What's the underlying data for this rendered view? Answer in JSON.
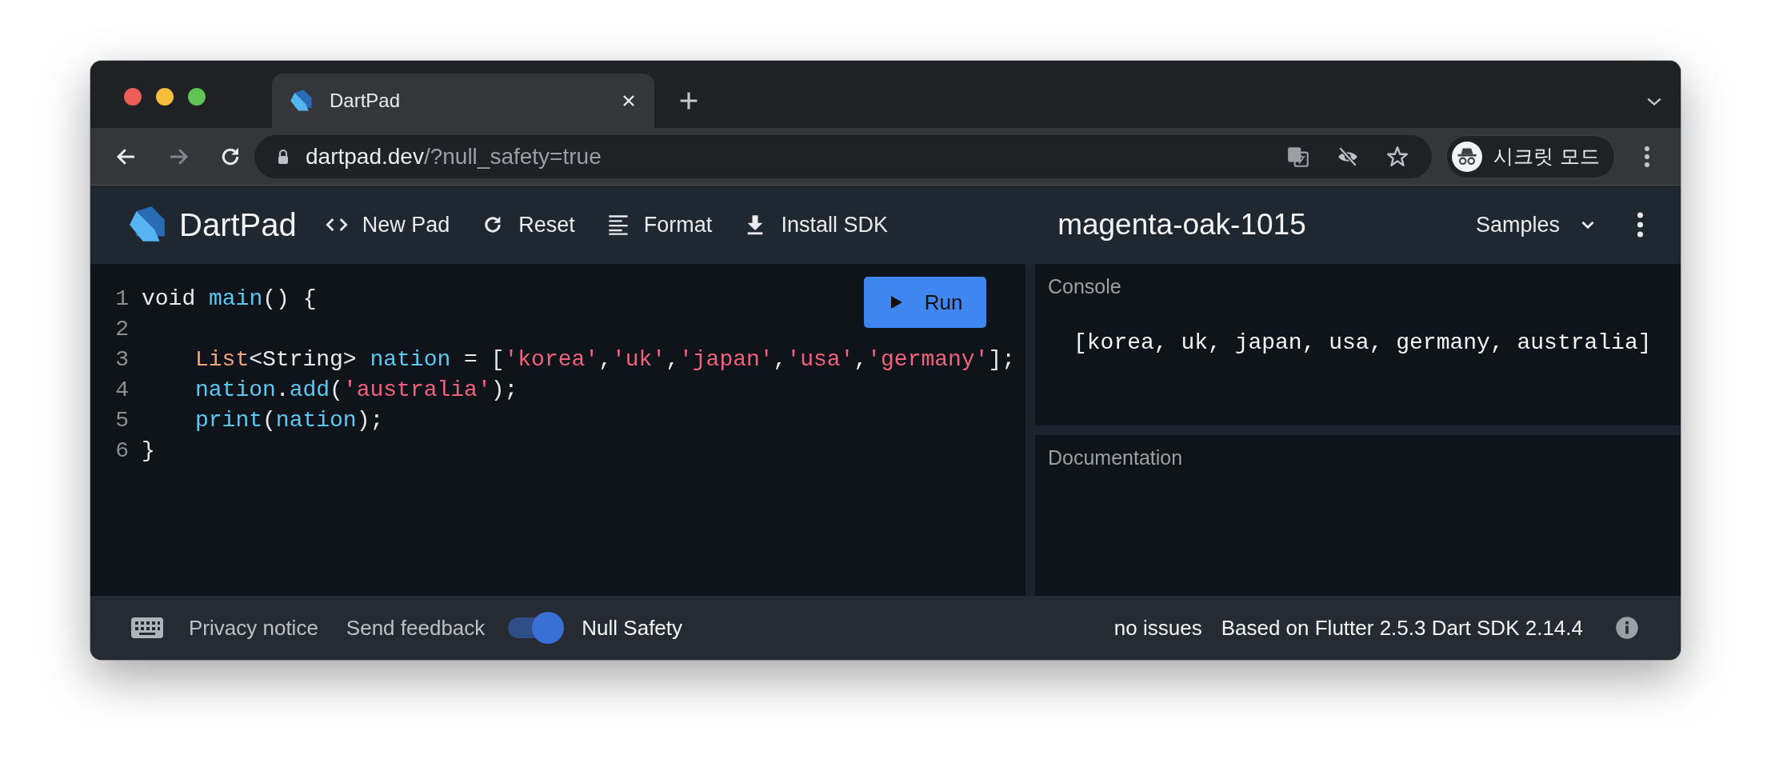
{
  "browser": {
    "tab": {
      "title": "DartPad"
    },
    "nav": [
      {
        "kind": "back",
        "disabled": false
      },
      {
        "kind": "forward",
        "disabled": true
      },
      {
        "kind": "reload",
        "disabled": false
      }
    ],
    "address": {
      "host": "dartpad.dev",
      "path": "/?null_safety=true"
    },
    "profile": {
      "label": "시크릿 모드"
    }
  },
  "app": {
    "logo": "DartPad",
    "actions": [
      {
        "kind": "code",
        "label": "New Pad"
      },
      {
        "kind": "reset",
        "label": "Reset"
      },
      {
        "kind": "format",
        "label": "Format"
      },
      {
        "kind": "download",
        "label": "Install SDK"
      }
    ],
    "pad_name": "magenta-oak-1015",
    "samples": "Samples"
  },
  "editor": {
    "run_button": "Run",
    "lines": [
      {
        "number": "1",
        "tokens": [
          {
            "text": "void ",
            "kind": "plain"
          },
          {
            "text": "main",
            "kind": "ident"
          },
          {
            "text": "() {",
            "kind": "plain"
          }
        ],
        "children": [
          {
            "number": "2"
          },
          {
            "number": "3",
            "tokens": [
              {
                "text": "List",
                "kind": "type"
              },
              {
                "text": "<String> ",
                "kind": "plain"
              },
              {
                "text": "nation",
                "kind": "ident"
              },
              {
                "text": " = [",
                "kind": "plain"
              },
              {
                "text": "'korea'",
                "kind": "string"
              },
              {
                "text": ",",
                "kind": "plain"
              },
              {
                "text": "'uk'",
                "kind": "string"
              },
              {
                "text": ",",
                "kind": "plain"
              },
              {
                "text": "'japan'",
                "kind": "string"
              },
              {
                "text": ",",
                "kind": "plain"
              },
              {
                "text": "'usa'",
                "kind": "string"
              },
              {
                "text": ",",
                "kind": "plain"
              },
              {
                "text": "'germany'",
                "kind": "string"
              },
              {
                "text": "];",
                "kind": "plain"
              }
            ]
          },
          {
            "number": "4",
            "tokens": [
              {
                "text": "nation",
                "kind": "ident"
              },
              {
                "text": ".",
                "kind": "plain"
              },
              {
                "text": "add",
                "kind": "ident"
              },
              {
                "text": "(",
                "kind": "plain"
              },
              {
                "text": "'australia'",
                "kind": "string"
              },
              {
                "text": ");",
                "kind": "plain"
              }
            ]
          },
          {
            "number": "5",
            "tokens": [
              {
                "text": "print",
                "kind": "ident"
              },
              {
                "text": "(",
                "kind": "plain"
              },
              {
                "text": "nation",
                "kind": "ident"
              },
              {
                "text": ");",
                "kind": "plain"
              }
            ]
          }
        ]
      },
      {
        "number": "6",
        "tokens": [
          {
            "text": "}",
            "kind": "plain"
          }
        ]
      }
    ]
  },
  "console": {
    "title": "Console",
    "output": "[korea, uk, japan, usa, germany, australia]"
  },
  "documentation": {
    "title": "Documentation"
  },
  "footer": {
    "links": [
      "Privacy notice",
      "Send feedback"
    ],
    "null_safety": {
      "label": "Null Safety",
      "on": true
    },
    "status": "no issues",
    "version": "Based on Flutter 2.5.3 Dart SDK 2.14.4"
  }
}
